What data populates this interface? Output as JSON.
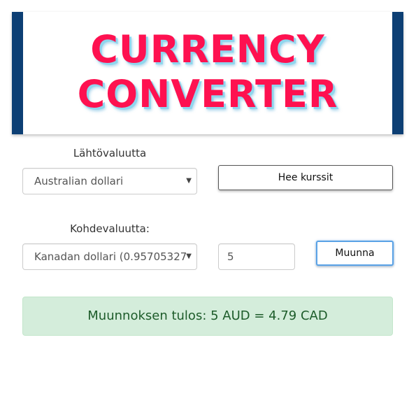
{
  "header": {
    "title_line1": "CURRENCY",
    "title_line2": "CONVERTER",
    "accent_color": "#fe1150",
    "bar_color": "#0d3f74"
  },
  "source": {
    "label": "Lähtövaluutta",
    "selected": "Australian dollari"
  },
  "target": {
    "label": "Kohdevaluutta:",
    "selected": "Kanadan dollari (0.95705327"
  },
  "buttons": {
    "rates_label": "Hee kurssit",
    "convert_label": "Muunna"
  },
  "amount": {
    "value": "5"
  },
  "result": {
    "text": "Muunnoksen tulos: 5 AUD = 4.79 CAD",
    "color": "#d4eddb"
  },
  "icons": {
    "dropdown": "caret-down-icon"
  }
}
